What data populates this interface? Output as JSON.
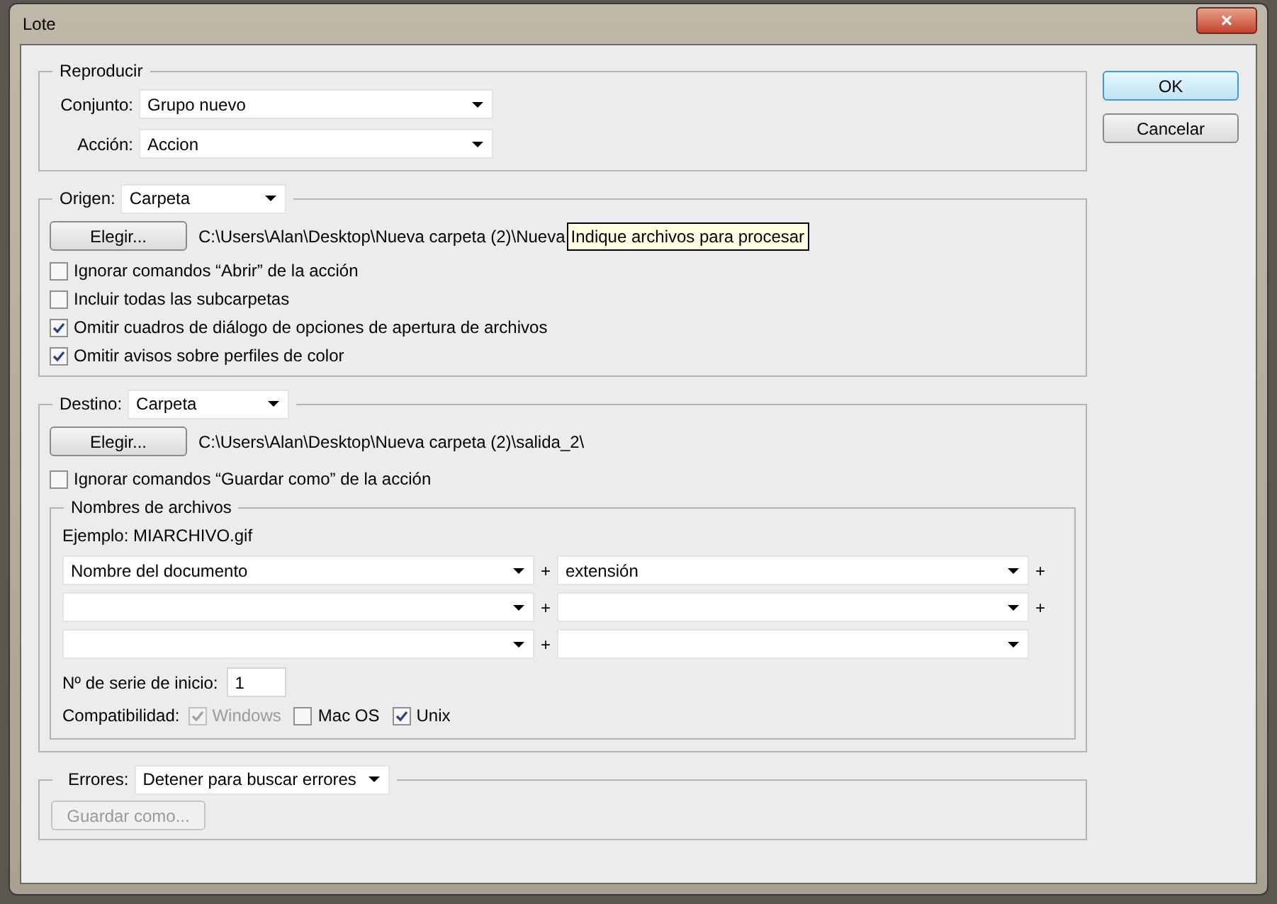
{
  "window": {
    "title": "Lote",
    "close": "×"
  },
  "buttons": [
    {
      "label": "OK",
      "default": true
    },
    {
      "label": "Cancelar",
      "default": false
    }
  ],
  "reproducir": {
    "legend": "Reproducir",
    "fields": [
      {
        "label": "Conjunto:",
        "value": "Grupo nuevo"
      },
      {
        "label": "Acción:",
        "value": "Accion"
      }
    ]
  },
  "origen": {
    "label": "Origen:",
    "value": "Carpeta",
    "choose": "Elegir...",
    "path": "C:\\Users\\Alan\\Desktop\\Nueva carpeta (2)\\Nueva",
    "tooltip": "Indique archivos para procesar",
    "options": [
      {
        "label": "Ignorar comandos “Abrir” de la acción",
        "checked": false
      },
      {
        "label": "Incluir todas las subcarpetas",
        "checked": false
      },
      {
        "label": "Omitir cuadros de diálogo de opciones de apertura de archivos",
        "checked": true
      },
      {
        "label": "Omitir avisos sobre perfiles de color",
        "checked": true
      }
    ]
  },
  "destino": {
    "label": "Destino:",
    "value": "Carpeta",
    "choose": "Elegir...",
    "path": "C:\\Users\\Alan\\Desktop\\Nueva carpeta (2)\\salida_2\\",
    "options": [
      {
        "label": "Ignorar comandos “Guardar como” de la acción",
        "checked": false
      }
    ],
    "names": {
      "legend": "Nombres de archivos",
      "example": "Ejemplo: MIARCHIVO.gif",
      "rows": [
        [
          {
            "value": "Nombre del documento",
            "plus": "+"
          },
          {
            "value": "extensión",
            "plus": "+"
          }
        ],
        [
          {
            "plus": "+"
          },
          {
            "plus": "+"
          }
        ],
        [
          {
            "plus": "+"
          },
          {}
        ]
      ],
      "serial_label": "Nº de serie de inicio:",
      "serial": "1",
      "compat_label": "Compatibilidad:",
      "compat": [
        {
          "label": "Windows",
          "checked": true,
          "disabled": true
        },
        {
          "label": "Mac OS",
          "checked": false,
          "disabled": false
        },
        {
          "label": "Unix",
          "checked": true,
          "disabled": false
        }
      ]
    }
  },
  "errores": {
    "label": "Errores:",
    "value": "Detener para buscar errores",
    "save": "Guardar como...",
    "save_disabled": true
  }
}
